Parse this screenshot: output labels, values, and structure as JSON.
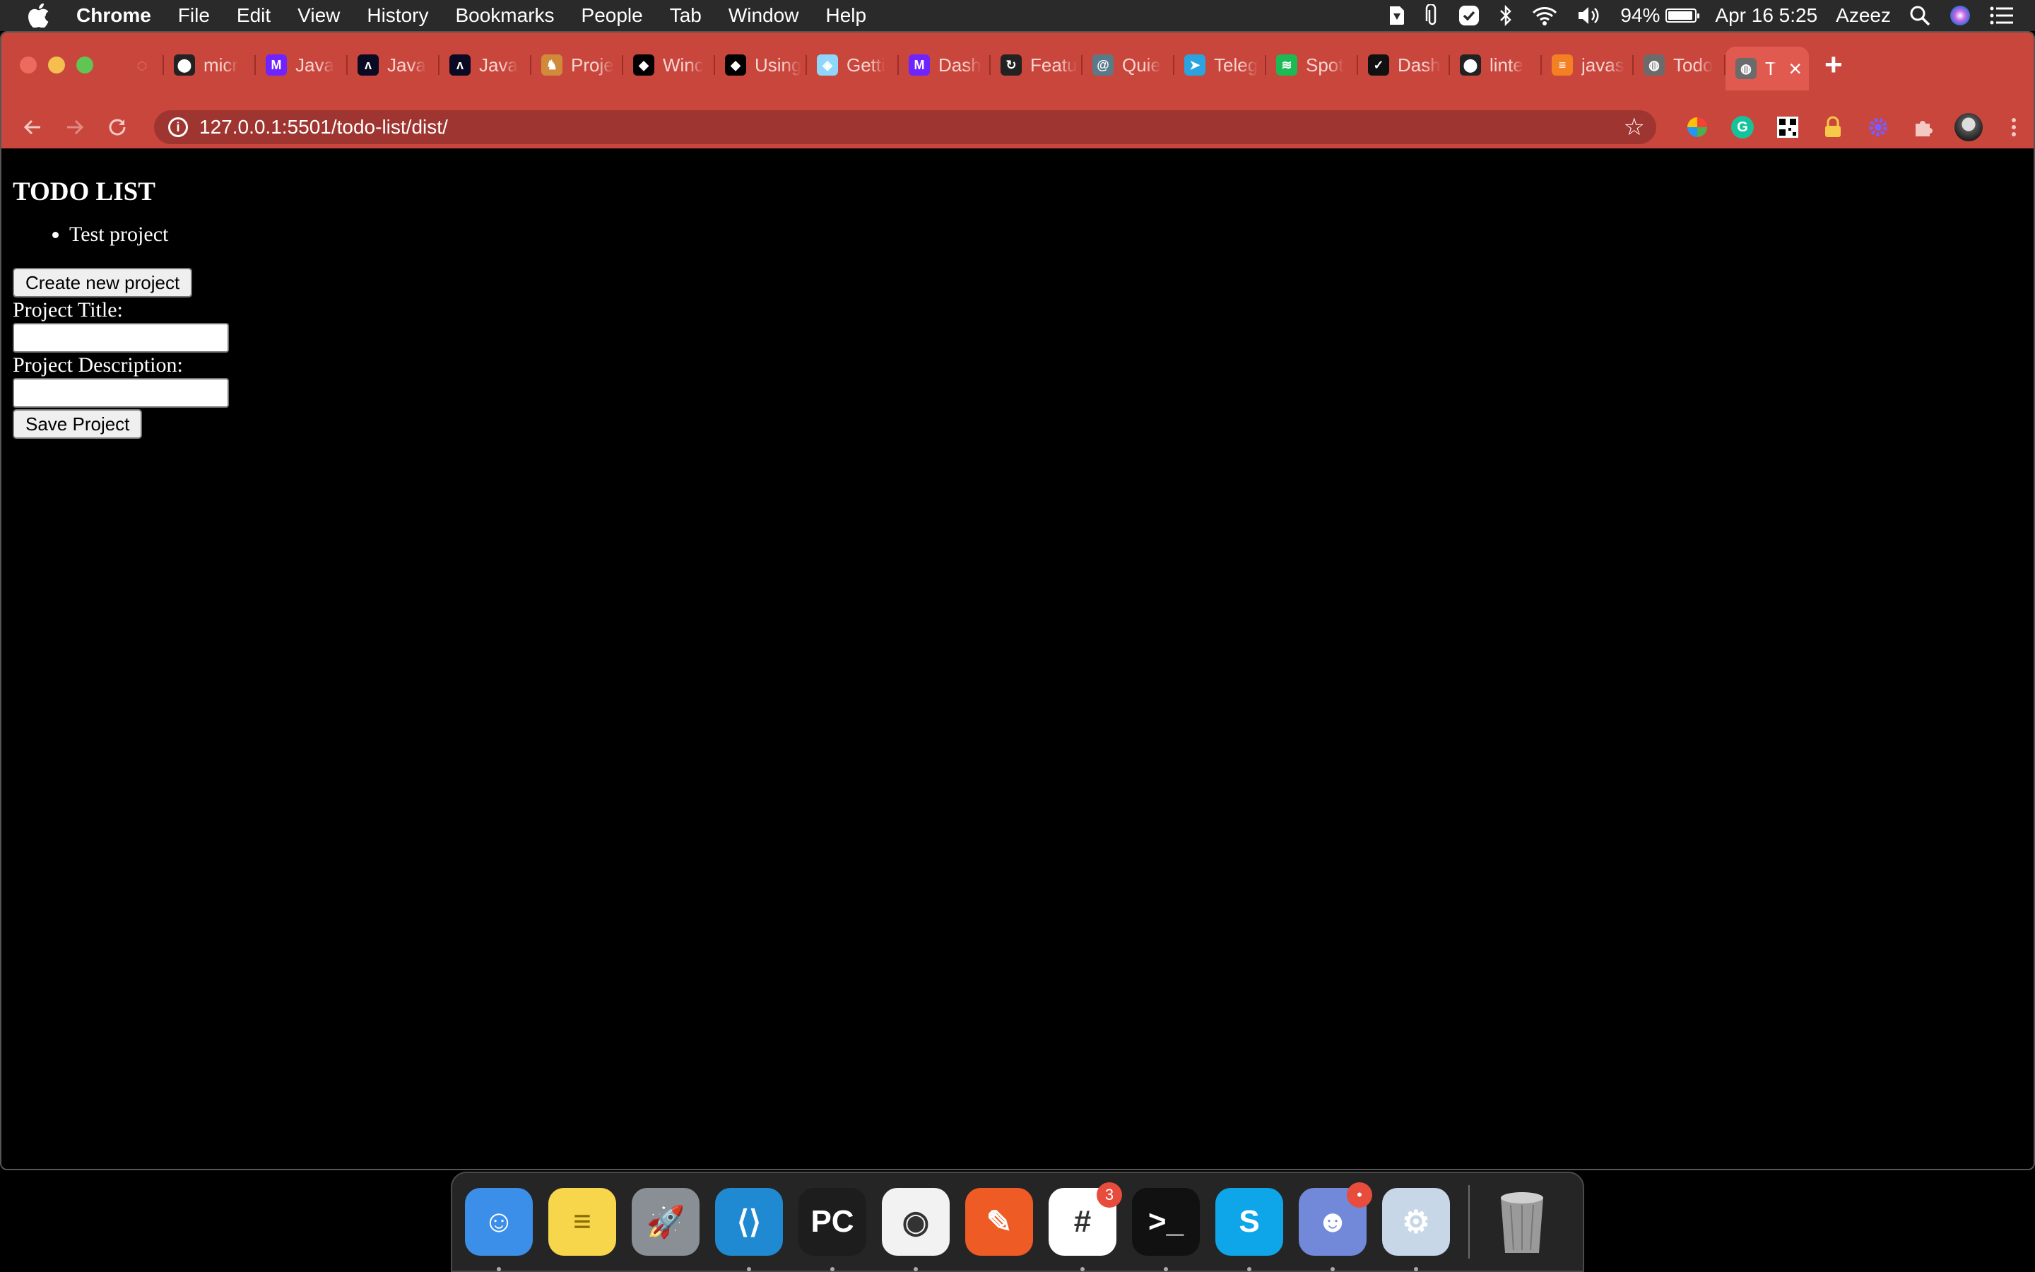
{
  "menubar": {
    "app_name": "Chrome",
    "items": [
      "File",
      "Edit",
      "View",
      "History",
      "Bookmarks",
      "People",
      "Tab",
      "Window",
      "Help"
    ],
    "battery_percent": "94%",
    "battery_level": 0.94,
    "date": "Apr 16",
    "time": "5:25",
    "user": "Azeez"
  },
  "browser": {
    "tabs": [
      {
        "title": "micr",
        "icon": "github-icon",
        "color": "#222222"
      },
      {
        "title": "Java",
        "icon": "microverse-icon",
        "color": "#6f23ff"
      },
      {
        "title": "Java",
        "icon": "freecodecamp-icon",
        "color": "#0a0a23"
      },
      {
        "title": "Java",
        "icon": "freecodecamp-icon",
        "color": "#0a0a23"
      },
      {
        "title": "Proje",
        "icon": "odin-icon",
        "color": "#d08a3a"
      },
      {
        "title": "Winc",
        "icon": "jsdoc-icon",
        "color": "#000000"
      },
      {
        "title": "Using",
        "icon": "jsdoc-icon",
        "color": "#000000"
      },
      {
        "title": "Getti",
        "icon": "webpack-icon",
        "color": "#8ed6fb"
      },
      {
        "title": "Dash",
        "icon": "microverse-icon",
        "color": "#6f23ff"
      },
      {
        "title": "Featu",
        "icon": "git-icon",
        "color": "#222222"
      },
      {
        "title": "Quie",
        "icon": "swirl-icon",
        "color": "#5a7a8a"
      },
      {
        "title": "Teleg",
        "icon": "telegram-icon",
        "color": "#2aa3df"
      },
      {
        "title": "Spot",
        "icon": "spotify-icon",
        "color": "#1db954"
      },
      {
        "title": "Dash",
        "icon": "checkmark-icon",
        "color": "#111111"
      },
      {
        "title": "linte",
        "icon": "github-icon",
        "color": "#222222"
      },
      {
        "title": "javas",
        "icon": "stackoverflow-icon",
        "color": "#f48024"
      },
      {
        "title": "Todo",
        "icon": "globe-icon",
        "color": "#6b6b6b"
      }
    ],
    "active_tab": {
      "title": "T",
      "icon": "globe-icon"
    },
    "new_tab_label": "+",
    "url": "127.0.0.1:5501/todo-list/dist/"
  },
  "page": {
    "heading": "TODO LIST",
    "projects": [
      "Test project"
    ],
    "create_button": "Create new project",
    "title_label": "Project Title:",
    "title_value": "",
    "description_label": "Project Description:",
    "description_value": "",
    "save_button": "Save Project"
  },
  "dock": {
    "apps": [
      {
        "name": "finder-icon",
        "color": "#3b8fe8",
        "running": true
      },
      {
        "name": "notes-icon",
        "color": "#f7d64b",
        "running": false
      },
      {
        "name": "launchpad-icon",
        "color": "#8a8f96",
        "running": false
      },
      {
        "name": "vscode-icon",
        "color": "#1f8ad2",
        "running": true
      },
      {
        "name": "pycharm-icon",
        "color": "#1d1d1d",
        "running": true
      },
      {
        "name": "chrome-icon",
        "color": "#f2f2f2",
        "running": true
      },
      {
        "name": "postman-icon",
        "color": "#ef5b25",
        "running": false
      },
      {
        "name": "slack-icon",
        "color": "#ffffff",
        "running": true,
        "badge": "3"
      },
      {
        "name": "terminal-icon",
        "color": "#111111",
        "running": true
      },
      {
        "name": "skype-icon",
        "color": "#0fa5e9",
        "running": true
      },
      {
        "name": "discord-icon",
        "color": "#7289da",
        "running": true,
        "badge": "•"
      },
      {
        "name": "instruments-icon",
        "color": "#c8d7e8",
        "running": true
      }
    ],
    "trash": {
      "name": "trash-icon",
      "color": "#9a9a9a"
    }
  }
}
